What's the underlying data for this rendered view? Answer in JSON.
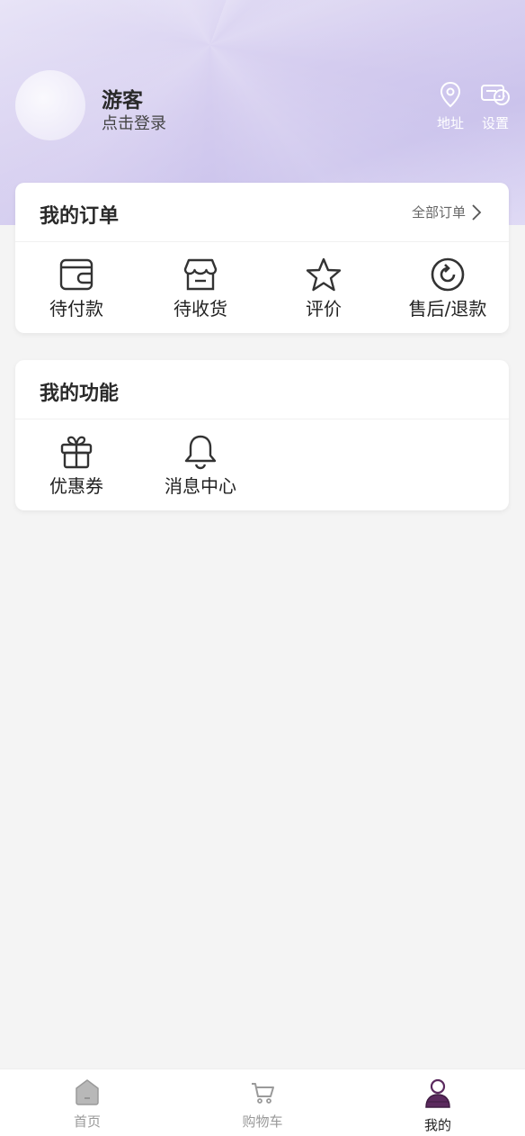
{
  "profile": {
    "name": "游客",
    "login_hint": "点击登录"
  },
  "top_actions": {
    "address_label": "地址",
    "settings_label": "设置"
  },
  "orders": {
    "title": "我的订单",
    "all_orders_label": "全部订单",
    "items": [
      {
        "label": "待付款",
        "icon": "wallet-icon"
      },
      {
        "label": "待收货",
        "icon": "store-icon"
      },
      {
        "label": "评价",
        "icon": "star-icon"
      },
      {
        "label": "售后/退款",
        "icon": "refresh-icon"
      }
    ]
  },
  "functions": {
    "title": "我的功能",
    "items": [
      {
        "label": "优惠券",
        "icon": "gift-icon"
      },
      {
        "label": "消息中心",
        "icon": "bell-icon"
      }
    ]
  },
  "tabbar": {
    "items": [
      {
        "label": "首页",
        "icon": "home-icon",
        "active": false
      },
      {
        "label": "购物车",
        "icon": "cart-icon",
        "active": false
      },
      {
        "label": "我的",
        "icon": "user-icon",
        "active": true
      }
    ]
  },
  "colors": {
    "header_accent": "#cbc3ec",
    "active_tab_icon": "#5b2a5e",
    "background": "#f4f4f4"
  }
}
